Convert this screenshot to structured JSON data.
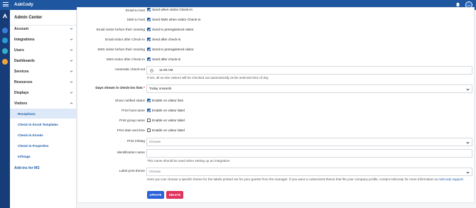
{
  "topbar": {
    "brand": "AskCody",
    "avatar": "m"
  },
  "sidebar": {
    "title": "Admin Center",
    "items": [
      {
        "label": "Account"
      },
      {
        "label": "Integrations"
      },
      {
        "label": "Users"
      },
      {
        "label": "Dashboards"
      },
      {
        "label": "Services"
      },
      {
        "label": "Resources"
      },
      {
        "label": "Displays"
      },
      {
        "label": "Visitors"
      }
    ],
    "visitor_subitems": [
      {
        "label": "Receptions"
      },
      {
        "label": "Check-in Kiosk Templates"
      },
      {
        "label": "Check-in Kiosks"
      },
      {
        "label": "Check-in Properties"
      },
      {
        "label": "Infotags"
      }
    ],
    "addins": "Add-ins for MS"
  },
  "form": {
    "partial_top": {
      "label": "Email to host",
      "text": "Send when visitor Check-In"
    },
    "rows": [
      {
        "label": "SMS to host",
        "text": "Send SMS when visitor Check-In",
        "checked": true
      },
      {
        "label": "Email visitor before their meeting",
        "text": "Send to preregistered visitor",
        "checked": true
      },
      {
        "label": "Email visitor after Check-In",
        "text": "Send after check-in",
        "checked": true
      },
      {
        "label": "SMS visitor before their meeting",
        "text": "Send to preregistered visitor",
        "checked": true
      },
      {
        "label": "SMS visitor after Check-In",
        "text": "Send after check-in",
        "checked": true
      }
    ],
    "auto_checkout": {
      "label": "Automatic check-out",
      "time": "11:00 AM",
      "help": "If set, all on-site visitors will be checked out automatically at the selected time of day"
    },
    "days_shown": {
      "label": "Days shown in check-ins lists",
      "required_mark": "*",
      "value": "Today onwards"
    },
    "rows2": [
      {
        "label": "Show notified status",
        "text": "Enable on visitor lists",
        "checked": true
      },
      {
        "label": "Print host name",
        "text": "Enable on visitor label",
        "checked": true
      },
      {
        "label": "Print group name",
        "text": "Enable on visitor label",
        "checked": false
      },
      {
        "label": "Print date and time",
        "text": "Enable on visitor label",
        "checked": false
      }
    ],
    "print_infotag": {
      "label": "Print infotag",
      "placeholder": "Choose"
    },
    "identification": {
      "label": "Identification name",
      "value": "",
      "help": "This name should be used when setting up an integration"
    },
    "label_theme": {
      "label": "Label print theme",
      "placeholder": "Choose",
      "help": "Here you can choose a specific theme for the labels printed out for your guests from the manager. If you want a customized theme that fits your company profile, contact AskCody for more information at",
      "help_link": "AskCody support"
    },
    "update_label": "UPDATE",
    "delete_label": "DELETE"
  },
  "colors": {
    "topbar": "#1e56a0",
    "rail": "#163d78",
    "accent": "#1f5da8",
    "update": "#2962d9",
    "delete": "#e0335d"
  }
}
